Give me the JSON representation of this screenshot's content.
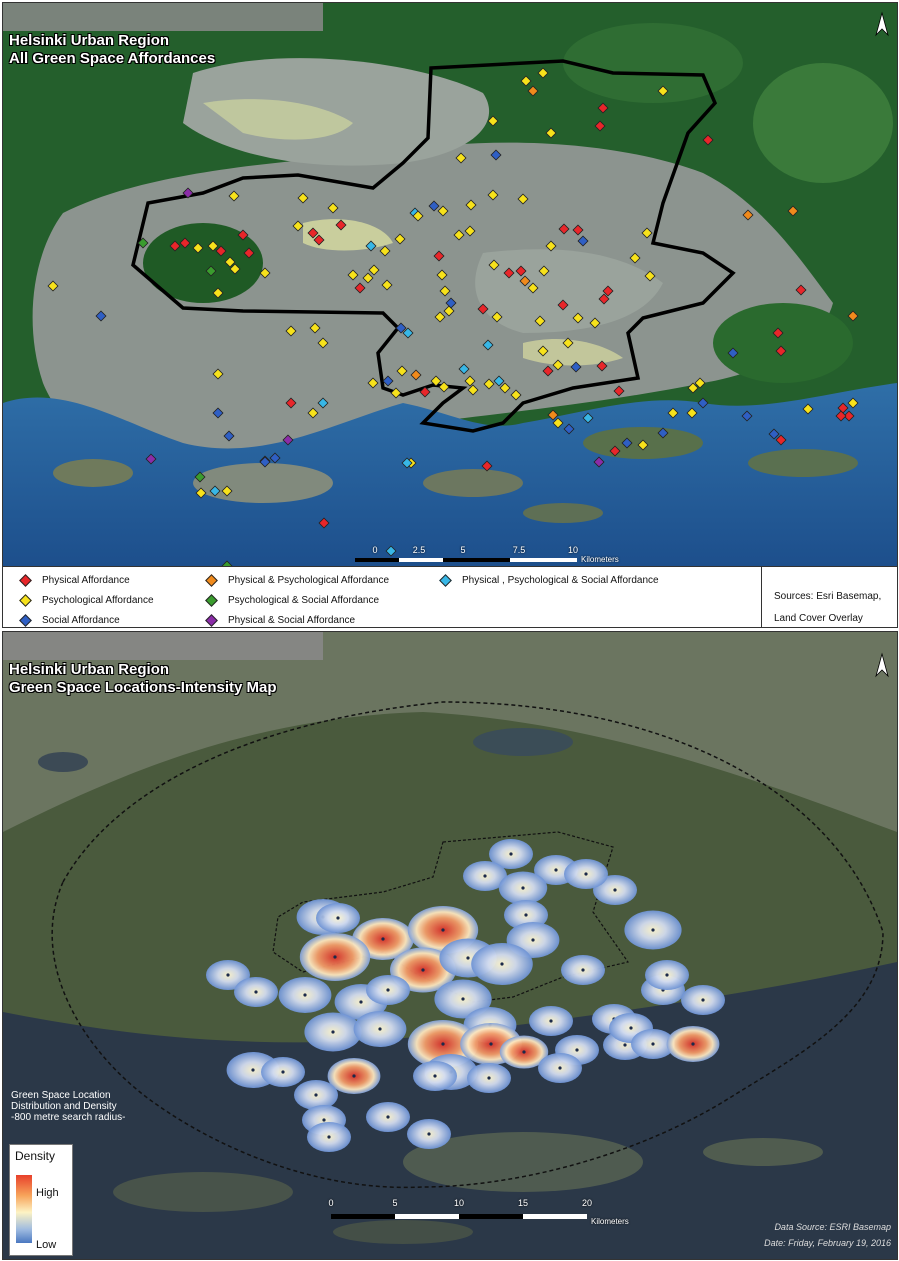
{
  "top_map": {
    "title_line1": "Helsinki Urban Region",
    "title_line2": "All Green Space Affordances",
    "north": "N",
    "scale": {
      "labels": [
        "0",
        "2.5",
        "5",
        "7.5",
        "10"
      ],
      "unit": "Kilometers"
    },
    "legend": [
      {
        "label": "Physical Affordance",
        "color": "#e8262a"
      },
      {
        "label": "Psychological Affordance",
        "color": "#f7e21b"
      },
      {
        "label": "Social Affordance",
        "color": "#2f5fc4"
      },
      {
        "label": "Physical & Psychological Affordance",
        "color": "#f08a1c"
      },
      {
        "label": "Psychological & Social Affordance",
        "color": "#3a9c2e"
      },
      {
        "label": "Physical & Social Affordance",
        "color": "#8b2ca8"
      },
      {
        "label": "Physical , Psychological & Social Affordance",
        "color": "#38b7e6"
      }
    ],
    "sources_line1": "Sources: Esri Basemap,",
    "sources_line2": "Land Cover Overlay"
  },
  "bottom_map": {
    "title_line1": "Helsinki Urban Region",
    "title_line2": "Green Space Locations-Intensity Map",
    "north": "N",
    "note_line1": "Green Space Location",
    "note_line2": "Distribution and Density",
    "note_line3": "-800 metre search radius-",
    "density_title": "Density",
    "density_high": "High",
    "density_low": "Low",
    "scale": {
      "labels": [
        "0",
        "5",
        "10",
        "15",
        "20"
      ],
      "unit": "Kilometers"
    },
    "credit_line1": "Data Source: ESRI Basemap",
    "credit_line2": "Date: Friday, February 19, 2016"
  }
}
